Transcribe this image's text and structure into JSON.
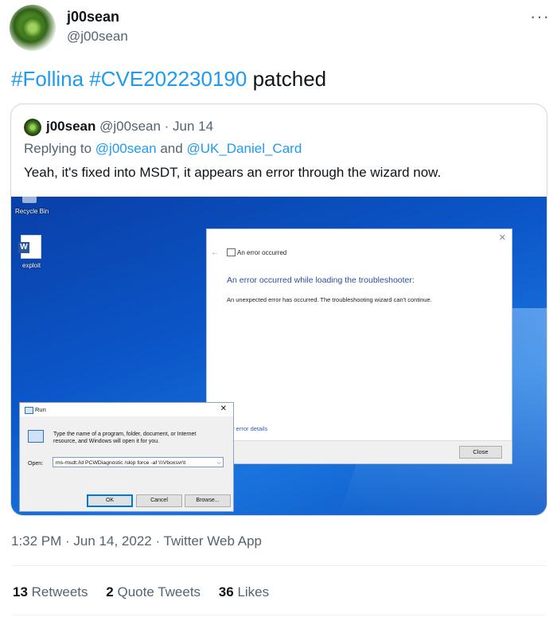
{
  "tweet": {
    "author_name": "j00sean",
    "author_handle": "@j00sean",
    "more_icon": "more-dots-icon",
    "text_tag1": "#Follina",
    "text_tag2": "#CVE202230190",
    "text_rest": "patched",
    "timestamp": "1:32 PM · Jun 14, 2022 · Twitter Web App",
    "stats": {
      "retweets_count": "13",
      "retweets_label": "Retweets",
      "quotes_count": "2",
      "quotes_label": "Quote Tweets",
      "likes_count": "36",
      "likes_label": "Likes"
    }
  },
  "quote": {
    "author_name": "j00sean",
    "author_meta": "@j00sean · Jun 14",
    "reply_prefix": "Replying to",
    "reply_user1": "@j00sean",
    "reply_and": "and",
    "reply_user2": "@UK_Daniel_Card",
    "text": "Yeah, it's fixed into MSDT, it appears an error through the wizard now."
  },
  "screenshot": {
    "desktop": {
      "recycle_bin": "Recycle Bin",
      "exploit_label": "exploit",
      "word_letter": "W"
    },
    "error_dialog": {
      "title": "An error occurred",
      "heading": "An error occurred while loading the troubleshooter:",
      "message": "An unexpected error has occurred. The troubleshooting wizard can't continue.",
      "details_link": "ew error details",
      "close_button": "Close"
    },
    "run_dialog": {
      "title": "Run",
      "description": "Type the name of a program, folder, document, or Internet resource, and Windows will open it for you.",
      "open_label": "Open:",
      "open_value": "ms-msdt:/id PCWDiagnostic /skip force -af \\\\\\Vboxsvr\\t",
      "ok": "OK",
      "cancel": "Cancel",
      "browse": "Browse..."
    }
  }
}
